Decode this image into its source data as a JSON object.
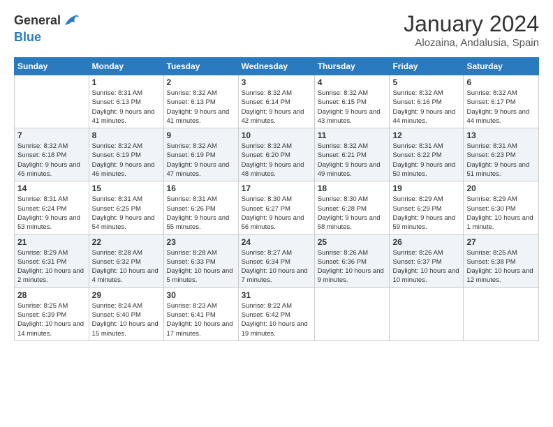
{
  "header": {
    "logo_general": "General",
    "logo_blue": "Blue",
    "title": "January 2024",
    "subtitle": "Alozaina, Andalusia, Spain"
  },
  "weekdays": [
    "Sunday",
    "Monday",
    "Tuesday",
    "Wednesday",
    "Thursday",
    "Friday",
    "Saturday"
  ],
  "weeks": [
    [
      {
        "day": "",
        "sunrise": "",
        "sunset": "",
        "daylight": ""
      },
      {
        "day": "1",
        "sunrise": "Sunrise: 8:31 AM",
        "sunset": "Sunset: 6:13 PM",
        "daylight": "Daylight: 9 hours and 41 minutes."
      },
      {
        "day": "2",
        "sunrise": "Sunrise: 8:32 AM",
        "sunset": "Sunset: 6:13 PM",
        "daylight": "Daylight: 9 hours and 41 minutes."
      },
      {
        "day": "3",
        "sunrise": "Sunrise: 8:32 AM",
        "sunset": "Sunset: 6:14 PM",
        "daylight": "Daylight: 9 hours and 42 minutes."
      },
      {
        "day": "4",
        "sunrise": "Sunrise: 8:32 AM",
        "sunset": "Sunset: 6:15 PM",
        "daylight": "Daylight: 9 hours and 43 minutes."
      },
      {
        "day": "5",
        "sunrise": "Sunrise: 8:32 AM",
        "sunset": "Sunset: 6:16 PM",
        "daylight": "Daylight: 9 hours and 44 minutes."
      },
      {
        "day": "6",
        "sunrise": "Sunrise: 8:32 AM",
        "sunset": "Sunset: 6:17 PM",
        "daylight": "Daylight: 9 hours and 44 minutes."
      }
    ],
    [
      {
        "day": "7",
        "sunrise": "Sunrise: 8:32 AM",
        "sunset": "Sunset: 6:18 PM",
        "daylight": "Daylight: 9 hours and 45 minutes."
      },
      {
        "day": "8",
        "sunrise": "Sunrise: 8:32 AM",
        "sunset": "Sunset: 6:19 PM",
        "daylight": "Daylight: 9 hours and 46 minutes."
      },
      {
        "day": "9",
        "sunrise": "Sunrise: 8:32 AM",
        "sunset": "Sunset: 6:19 PM",
        "daylight": "Daylight: 9 hours and 47 minutes."
      },
      {
        "day": "10",
        "sunrise": "Sunrise: 8:32 AM",
        "sunset": "Sunset: 6:20 PM",
        "daylight": "Daylight: 9 hours and 48 minutes."
      },
      {
        "day": "11",
        "sunrise": "Sunrise: 8:32 AM",
        "sunset": "Sunset: 6:21 PM",
        "daylight": "Daylight: 9 hours and 49 minutes."
      },
      {
        "day": "12",
        "sunrise": "Sunrise: 8:31 AM",
        "sunset": "Sunset: 6:22 PM",
        "daylight": "Daylight: 9 hours and 50 minutes."
      },
      {
        "day": "13",
        "sunrise": "Sunrise: 8:31 AM",
        "sunset": "Sunset: 6:23 PM",
        "daylight": "Daylight: 9 hours and 51 minutes."
      }
    ],
    [
      {
        "day": "14",
        "sunrise": "Sunrise: 8:31 AM",
        "sunset": "Sunset: 6:24 PM",
        "daylight": "Daylight: 9 hours and 53 minutes."
      },
      {
        "day": "15",
        "sunrise": "Sunrise: 8:31 AM",
        "sunset": "Sunset: 6:25 PM",
        "daylight": "Daylight: 9 hours and 54 minutes."
      },
      {
        "day": "16",
        "sunrise": "Sunrise: 8:31 AM",
        "sunset": "Sunset: 6:26 PM",
        "daylight": "Daylight: 9 hours and 55 minutes."
      },
      {
        "day": "17",
        "sunrise": "Sunrise: 8:30 AM",
        "sunset": "Sunset: 6:27 PM",
        "daylight": "Daylight: 9 hours and 56 minutes."
      },
      {
        "day": "18",
        "sunrise": "Sunrise: 8:30 AM",
        "sunset": "Sunset: 6:28 PM",
        "daylight": "Daylight: 9 hours and 58 minutes."
      },
      {
        "day": "19",
        "sunrise": "Sunrise: 8:29 AM",
        "sunset": "Sunset: 6:29 PM",
        "daylight": "Daylight: 9 hours and 59 minutes."
      },
      {
        "day": "20",
        "sunrise": "Sunrise: 8:29 AM",
        "sunset": "Sunset: 6:30 PM",
        "daylight": "Daylight: 10 hours and 1 minute."
      }
    ],
    [
      {
        "day": "21",
        "sunrise": "Sunrise: 8:29 AM",
        "sunset": "Sunset: 6:31 PM",
        "daylight": "Daylight: 10 hours and 2 minutes."
      },
      {
        "day": "22",
        "sunrise": "Sunrise: 8:28 AM",
        "sunset": "Sunset: 6:32 PM",
        "daylight": "Daylight: 10 hours and 4 minutes."
      },
      {
        "day": "23",
        "sunrise": "Sunrise: 8:28 AM",
        "sunset": "Sunset: 6:33 PM",
        "daylight": "Daylight: 10 hours and 5 minutes."
      },
      {
        "day": "24",
        "sunrise": "Sunrise: 8:27 AM",
        "sunset": "Sunset: 6:34 PM",
        "daylight": "Daylight: 10 hours and 7 minutes."
      },
      {
        "day": "25",
        "sunrise": "Sunrise: 8:26 AM",
        "sunset": "Sunset: 6:36 PM",
        "daylight": "Daylight: 10 hours and 9 minutes."
      },
      {
        "day": "26",
        "sunrise": "Sunrise: 8:26 AM",
        "sunset": "Sunset: 6:37 PM",
        "daylight": "Daylight: 10 hours and 10 minutes."
      },
      {
        "day": "27",
        "sunrise": "Sunrise: 8:25 AM",
        "sunset": "Sunset: 6:38 PM",
        "daylight": "Daylight: 10 hours and 12 minutes."
      }
    ],
    [
      {
        "day": "28",
        "sunrise": "Sunrise: 8:25 AM",
        "sunset": "Sunset: 6:39 PM",
        "daylight": "Daylight: 10 hours and 14 minutes."
      },
      {
        "day": "29",
        "sunrise": "Sunrise: 8:24 AM",
        "sunset": "Sunset: 6:40 PM",
        "daylight": "Daylight: 10 hours and 15 minutes."
      },
      {
        "day": "30",
        "sunrise": "Sunrise: 8:23 AM",
        "sunset": "Sunset: 6:41 PM",
        "daylight": "Daylight: 10 hours and 17 minutes."
      },
      {
        "day": "31",
        "sunrise": "Sunrise: 8:22 AM",
        "sunset": "Sunset: 6:42 PM",
        "daylight": "Daylight: 10 hours and 19 minutes."
      },
      {
        "day": "",
        "sunrise": "",
        "sunset": "",
        "daylight": ""
      },
      {
        "day": "",
        "sunrise": "",
        "sunset": "",
        "daylight": ""
      },
      {
        "day": "",
        "sunrise": "",
        "sunset": "",
        "daylight": ""
      }
    ]
  ]
}
